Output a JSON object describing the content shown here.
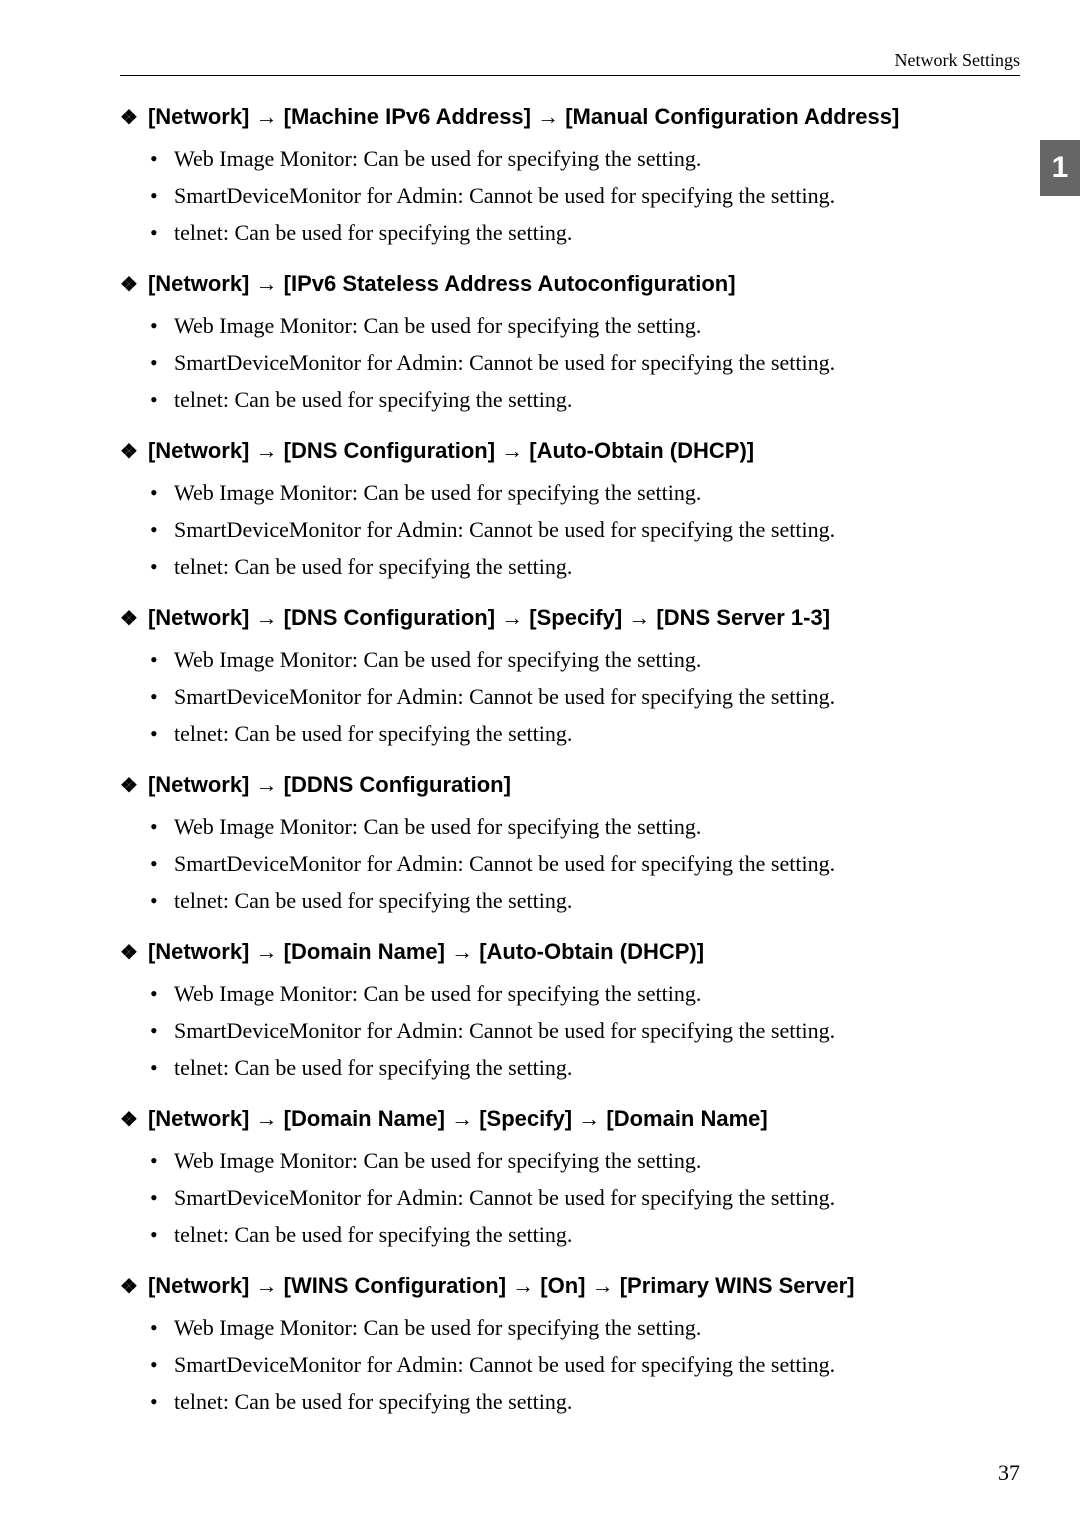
{
  "header": {
    "breadcrumb": "Network Settings"
  },
  "chapter": {
    "number": "1"
  },
  "sections": [
    {
      "title_parts": [
        "[Network]",
        "[Machine IPv6 Address]",
        "[Manual Configuration Address]"
      ],
      "bullets": [
        "Web Image Monitor: Can be used for specifying the setting.",
        "SmartDeviceMonitor for Admin: Cannot be used for specifying the setting.",
        "telnet: Can be used for specifying the setting."
      ]
    },
    {
      "title_parts": [
        "[Network]",
        "[IPv6 Stateless Address Autoconfiguration]"
      ],
      "bullets": [
        "Web Image Monitor: Can be used for specifying the setting.",
        "SmartDeviceMonitor for Admin: Cannot be used for specifying the setting.",
        "telnet: Can be used for specifying the setting."
      ]
    },
    {
      "title_parts": [
        "[Network]",
        "[DNS Configuration]",
        "[Auto-Obtain (DHCP)]"
      ],
      "bullets": [
        "Web Image Monitor: Can be used for specifying the setting.",
        "SmartDeviceMonitor for Admin: Cannot be used for specifying the setting.",
        "telnet: Can be used for specifying the setting."
      ]
    },
    {
      "title_parts": [
        "[Network]",
        "[DNS Configuration]",
        "[Specify]",
        "[DNS Server 1-3]"
      ],
      "bullets": [
        "Web Image Monitor: Can be used for specifying the setting.",
        "SmartDeviceMonitor for Admin: Cannot be used for specifying the setting.",
        "telnet: Can be used for specifying the setting."
      ]
    },
    {
      "title_parts": [
        "[Network]",
        "[DDNS Configuration]"
      ],
      "bullets": [
        "Web Image Monitor: Can be used for specifying the setting.",
        "SmartDeviceMonitor for Admin: Cannot be used for specifying the setting.",
        "telnet: Can be used for specifying the setting."
      ]
    },
    {
      "title_parts": [
        "[Network]",
        "[Domain Name]",
        "[Auto-Obtain (DHCP)]"
      ],
      "bullets": [
        "Web Image Monitor: Can be used for specifying the setting.",
        "SmartDeviceMonitor for Admin: Cannot be used for specifying the setting.",
        "telnet: Can be used for specifying the setting."
      ]
    },
    {
      "title_parts": [
        "[Network]",
        "[Domain Name]",
        "[Specify]",
        "[Domain Name]"
      ],
      "bullets": [
        "Web Image Monitor: Can be used for specifying the setting.",
        "SmartDeviceMonitor for Admin: Cannot be used for specifying the setting.",
        "telnet: Can be used for specifying the setting."
      ]
    },
    {
      "title_parts": [
        "[Network]",
        "[WINS Configuration]",
        "[On]",
        "[Primary WINS Server]"
      ],
      "bullets": [
        "Web Image Monitor: Can be used for specifying the setting.",
        "SmartDeviceMonitor for Admin: Cannot be used for specifying the setting.",
        "telnet: Can be used for specifying the setting."
      ]
    }
  ],
  "arrow_glyph": "→",
  "diamond_glyph": "❖",
  "page_number": "37"
}
